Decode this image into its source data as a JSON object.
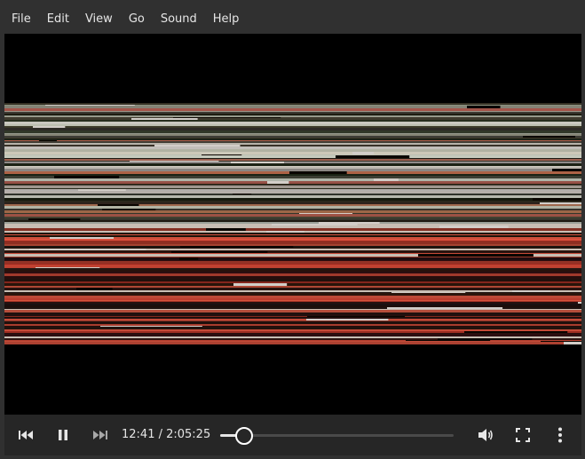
{
  "menubar": {
    "items": [
      {
        "label": "File"
      },
      {
        "label": "Edit"
      },
      {
        "label": "View"
      },
      {
        "label": "Go"
      },
      {
        "label": "Sound"
      },
      {
        "label": "Help"
      }
    ]
  },
  "player": {
    "time_display": "12:41 / 2:05:25",
    "progress": 0.101,
    "playing": true,
    "icons": {
      "previous": "skip-previous-icon",
      "play_pause": "pause-icon",
      "next": "skip-next-icon",
      "volume": "volume-icon",
      "fullscreen": "fullscreen-icon",
      "menu": "more-vertical-icon"
    }
  },
  "colors": {
    "chrome": "#303030",
    "controls_bg": "#262626",
    "text": "#e6e6e6",
    "video_bg": "#000000"
  }
}
